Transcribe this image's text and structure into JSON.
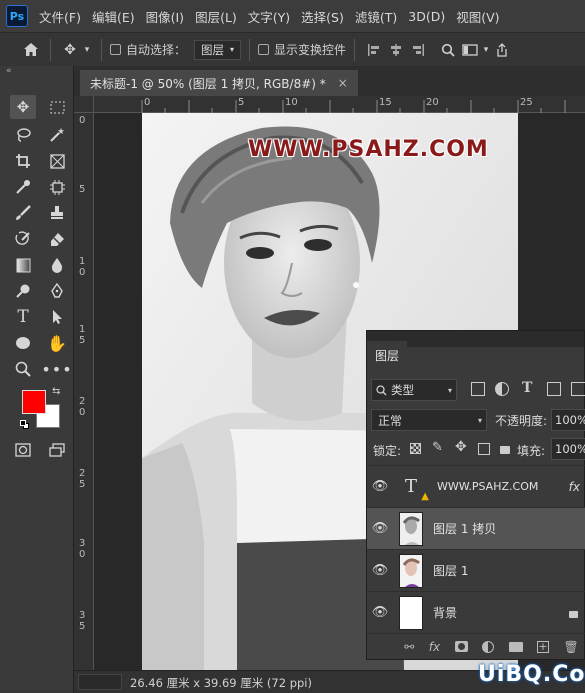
{
  "app": {
    "logo": "Ps"
  },
  "menu": [
    "文件(F)",
    "编辑(E)",
    "图像(I)",
    "图层(L)",
    "文字(Y)",
    "选择(S)",
    "滤镜(T)",
    "3D(D)",
    "视图(V)"
  ],
  "options": {
    "auto_select_label": "自动选择：",
    "auto_select_value": "图层",
    "show_transform_label": "显示变换控件"
  },
  "document": {
    "tab_title": "未标题-1 @ 50% (图层 1 拷贝, RGB/8#) *",
    "close": "×",
    "status": "26.46 厘米 x 39.69 厘米 (72 ppi)"
  },
  "canvas": {
    "watermark": "WWW.PSAHZ.COM"
  },
  "rulers": {
    "top": [
      "0",
      "5",
      "10",
      "15",
      "20",
      "25"
    ],
    "left": [
      "0",
      "5",
      "1\n0",
      "1\n5",
      "2\n0",
      "2\n5",
      "3\n0",
      "3\n5"
    ]
  },
  "layers_panel": {
    "tab": "图层",
    "filter_label": "类型",
    "blend_mode": "正常",
    "opacity_label": "不透明度:",
    "opacity_value": "100%",
    "lock_label": "锁定:",
    "fill_label": "填充:",
    "fill_value": "100%",
    "layers": [
      {
        "name": "WWW.PSAHZ.COM",
        "type": "text",
        "fx": "fx"
      },
      {
        "name": "图层 1 拷贝",
        "type": "image",
        "selected": true
      },
      {
        "name": "图层 1",
        "type": "image"
      },
      {
        "name": "背景",
        "type": "background"
      }
    ],
    "footer_icons": [
      "link-icon",
      "fx-icon",
      "mask-icon",
      "adjustment-icon",
      "folder-icon",
      "new-layer-icon",
      "trash-icon"
    ]
  },
  "footer_watermark": "UiBQ.CoM",
  "colors": {
    "foreground": "#ff0000",
    "background": "#ffffff",
    "watermark_text": "#8a1a1a"
  }
}
